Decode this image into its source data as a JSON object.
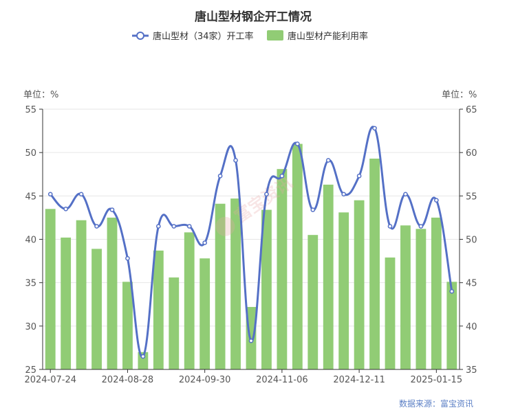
{
  "chart_data": {
    "type": "bar",
    "title": "唐山型材钢企开工情况",
    "legend": {
      "placement": "top-center",
      "items": [
        {
          "label": "唐山型材（34家）开工率",
          "kind": "line",
          "color": "#5470c6"
        },
        {
          "label": "唐山型材产能利用率",
          "kind": "bar",
          "color": "#91cc75"
        }
      ]
    },
    "left_axis": {
      "unit_label": "单位：%",
      "min": 25,
      "max": 55,
      "ticks": [
        "25",
        "30",
        "35",
        "40",
        "45",
        "50",
        "55"
      ]
    },
    "right_axis": {
      "unit_label": "单位：%",
      "min": 35,
      "max": 65,
      "ticks": [
        "35",
        "40",
        "45",
        "50",
        "55",
        "60",
        "65"
      ]
    },
    "x_tick_labels": [
      "2024-07-24",
      "2024-08-28",
      "2024-09-30",
      "2024-11-06",
      "2024-12-11",
      "2025-01-15"
    ],
    "x_tick_positions": [
      0,
      5,
      10,
      15,
      20,
      25
    ],
    "series": [
      {
        "name": "唐山型材（34家）开工率",
        "type": "line",
        "axis": "left",
        "values": [
          45.2,
          43.5,
          45.2,
          41.5,
          43.4,
          37.8,
          26.5,
          41.5,
          41.5,
          41.5,
          39.6,
          47.3,
          49.1,
          28.3,
          45.2,
          47.3,
          51.0,
          43.4,
          49.1,
          45.2,
          47.3,
          52.8,
          41.5,
          45.2,
          41.5,
          44.5,
          34.0
        ]
      },
      {
        "name": "唐山型材产能利用率",
        "type": "bar",
        "axis": "right",
        "values": [
          53.5,
          50.2,
          52.2,
          48.9,
          52.5,
          45.1,
          37.0,
          48.7,
          45.6,
          50.8,
          47.8,
          54.1,
          54.7,
          42.2,
          53.4,
          58.1,
          61.0,
          50.5,
          56.3,
          53.1,
          54.5,
          59.3,
          47.9,
          51.6,
          51.2,
          52.5,
          45.1
        ]
      }
    ],
    "grid": true,
    "watermark": "富宝资讯",
    "source": "数据来源：富宝资讯"
  }
}
